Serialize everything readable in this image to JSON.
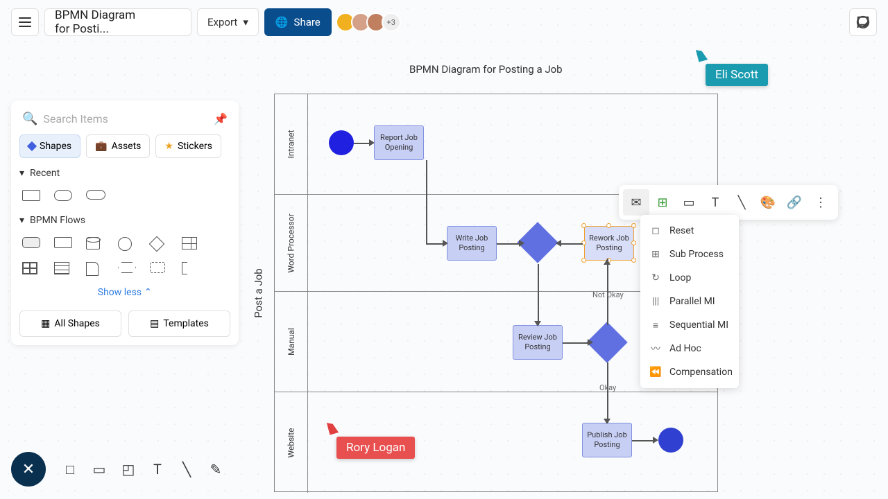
{
  "header": {
    "title": "BPMN Diagram for Posti...",
    "export": "Export",
    "share": "Share",
    "avatar_more": "+3"
  },
  "sidebar": {
    "search_placeholder": "Search Items",
    "tabs": {
      "shapes": "Shapes",
      "assets": "Assets",
      "stickers": "Stickers"
    },
    "recent": "Recent",
    "bpmn_flows": "BPMN Flows",
    "show_less": "Show less",
    "all_shapes": "All Shapes",
    "templates": "Templates"
  },
  "diagram": {
    "title": "BPMN Diagram for Posting a Job",
    "pool": "Post a Job",
    "lanes": [
      "Intranet",
      "Word Processor",
      "Manual",
      "Website"
    ],
    "tasks": {
      "report": "Report Job Opening",
      "write": "Write Job Posting",
      "rework": "Rework Job Posting",
      "review": "Review Job Posting",
      "publish": "Publish Job Posting"
    },
    "edges": {
      "not_okay": "Not Okay",
      "okay": "Okay"
    }
  },
  "cursors": {
    "eli": "Eli Scott",
    "rory": "Rory Logan"
  },
  "context_menu": [
    "Reset",
    "Sub Process",
    "Loop",
    "Parallel MI",
    "Sequential MI",
    "Ad Hoc",
    "Compensation"
  ]
}
